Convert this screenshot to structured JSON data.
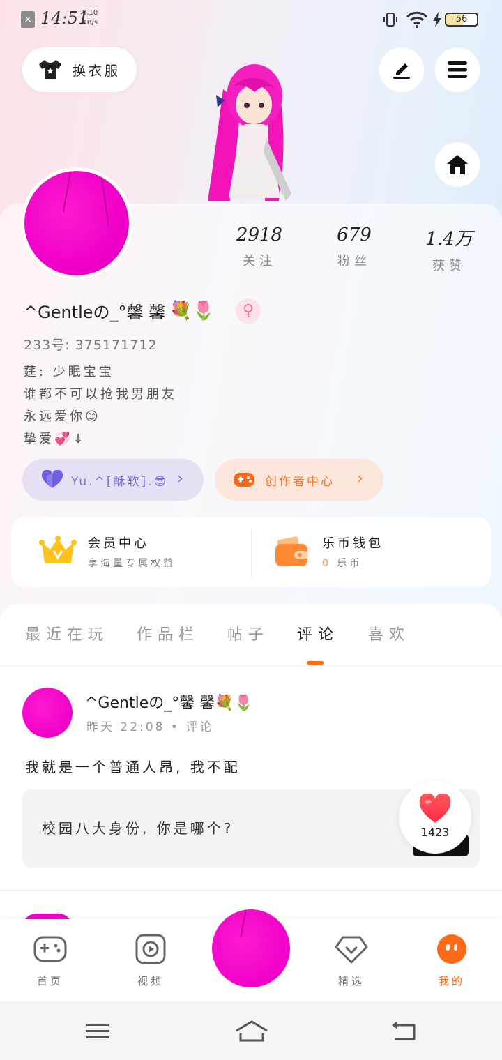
{
  "status_bar": {
    "time": "14:51",
    "net_speed_value": "0.10",
    "net_speed_unit": "KB/s",
    "battery": "56"
  },
  "top": {
    "wardrobe_label": "换衣服"
  },
  "profile": {
    "stats": [
      {
        "value": "2918",
        "label": "关注"
      },
      {
        "value": "679",
        "label": "粉丝"
      },
      {
        "value": "1.4万",
        "label": "获赞"
      }
    ],
    "username": "^Gentleの_°馨 馨",
    "username_emoji": "💐🌷",
    "gender_symbol": "♀",
    "uid": "233号:  375171712",
    "bio_lines": [
      "莛: 少眠宝宝",
      "谁都不可以抢我男朋友",
      "永远爱你😊",
      "挚爱💞↓"
    ]
  },
  "chips": {
    "follow_label": "Yu.^[酥软].😎",
    "creator_label": "创作者中心"
  },
  "services": {
    "vip_title": "会员中心",
    "vip_sub": "享海量专属权益",
    "wallet_title": "乐币钱包",
    "wallet_value": "0",
    "wallet_unit": "乐币"
  },
  "tabs": [
    "最近在玩",
    "作品栏",
    "帖子",
    "评论",
    "喜欢"
  ],
  "active_tab": "评论",
  "post": {
    "author": "^Gentleの_°馨 馨💐🌷",
    "meta": "昨天 22:08 • 评论",
    "text": "我就是一个普通人昂, 我不配",
    "quote": "校园八大身份, 你是哪个?",
    "likes": "1423"
  },
  "bottom_nav": [
    {
      "label": "首页",
      "icon": "gamepad-icon"
    },
    {
      "label": "视频",
      "icon": "video-play-icon"
    },
    {
      "label": "精选",
      "icon": "heart-shield-icon"
    },
    {
      "label": "我的",
      "icon": "profile-face-icon"
    }
  ],
  "colors": {
    "accent": "#ff6a16",
    "avatar_pink": "#f000c8",
    "follow_chip": "#7b6de0",
    "creator_chip": "#f07a2c"
  }
}
